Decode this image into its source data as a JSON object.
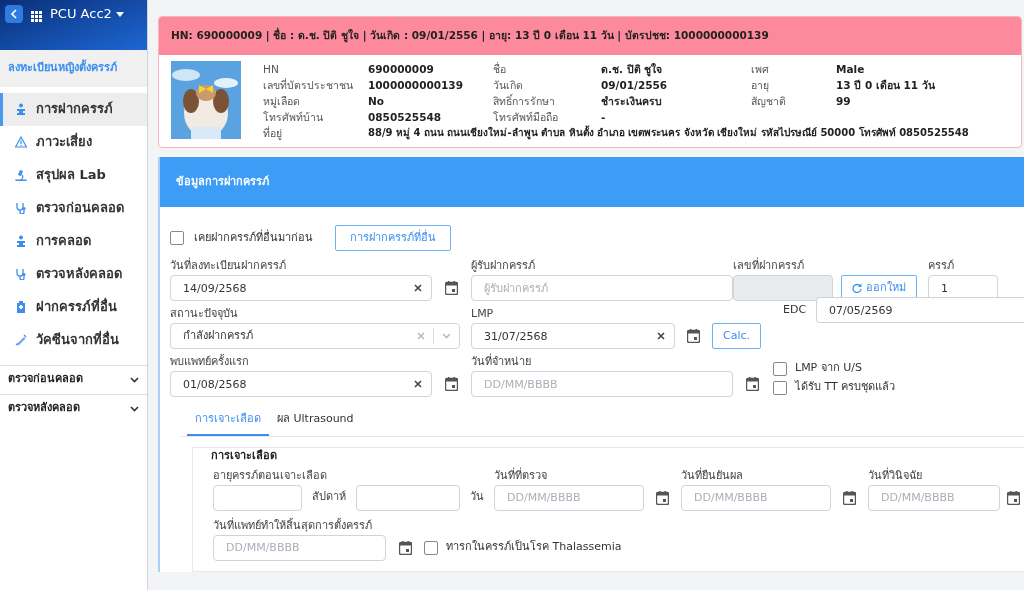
{
  "app": {
    "title": "PCU Acc2"
  },
  "sidebar": {
    "section_title": "ลงทะเบียนหญิงตั้งครรภ์",
    "items": [
      {
        "label": "การฝากครรภ์",
        "selected": true
      },
      {
        "label": "ภาวะเสี่ยง",
        "selected": false
      },
      {
        "label": "สรุปผล Lab",
        "selected": false
      },
      {
        "label": "ตรวจก่อนคลอด",
        "selected": false
      },
      {
        "label": "การคลอด",
        "selected": false
      },
      {
        "label": "ตรวจหลังคลอด",
        "selected": false
      },
      {
        "label": "ฝากครรภ์ที่อื่น",
        "selected": false
      },
      {
        "label": "วัคซีนจากที่อื่น",
        "selected": false
      }
    ],
    "groups": [
      {
        "label": "ตรวจก่อนคลอด",
        "expanded": false
      },
      {
        "label": "ตรวจหลังคลอด",
        "expanded": false
      }
    ]
  },
  "patient": {
    "banner": "HN: 690000009 | ชื่อ : ด.ช. ปิติ ชูใจ | วันเกิด : 09/01/2556 | อายุ: 13 ปี 0 เดือน 11 วัน | บัตรปชช: 1000000000139",
    "info": [
      {
        "label": "HN",
        "value": "690000009"
      },
      {
        "label": "ชื่อ",
        "value": "ด.ช. ปิติ ชูใจ"
      },
      {
        "label": "เพศ",
        "value": "Male"
      },
      {
        "label": "เลขที่บัตรประชาชน",
        "value": "1000000000139"
      },
      {
        "label": "วันเกิด",
        "value": "09/01/2556"
      },
      {
        "label": "อายุ",
        "value": "13 ปี 0 เดือน 11 วัน"
      },
      {
        "label": "หมู่เลือด",
        "value": "No"
      },
      {
        "label": "สิทธิ์การรักษา",
        "value": "ชำระเงินครบ"
      },
      {
        "label": "สัญชาติ",
        "value": "99"
      },
      {
        "label": "โทรศัพท์บ้าน",
        "value": "0850525548"
      },
      {
        "label": "โทรศัพท์มือถือ",
        "value": "-"
      }
    ],
    "address": {
      "label": "ที่อยู่",
      "value": "88/9 หมู่ 4 ถนน ถนนเชียงใหม่-ลำพูน ตำบล หินตั้ง อำเภอ เขตพระนคร จังหวัด เชียงใหม่ รหัสไปรษณีย์ 50000 โทรศัพท์ 0850525548"
    }
  },
  "form": {
    "title": "ข้อมูลการฝากครรภ์",
    "prior": {
      "label": "เคยฝากครรภ์ที่อื่นมาก่อน",
      "checked": false
    },
    "other_button": "การฝากครรภ์ที่อื่น",
    "rows": [
      [
        {
          "kind": "date",
          "label": "วันที่ลงทะเบียนฝากครรภ์",
          "value": "14/09/2568"
        },
        {
          "kind": "text",
          "label": "ผู้รับฝากครรภ์",
          "placeholder": "ผู้รับฝากครรภ์"
        },
        {
          "kind": "readonly",
          "label": "เลขที่ฝากครรภ์",
          "button": "ออกใหม่"
        },
        {
          "kind": "number",
          "label": "ครรภ์",
          "value": "1"
        }
      ],
      [
        {
          "kind": "select",
          "label": "สถานะปัจจุบัน",
          "value": "กำลังฝากครรภ์"
        },
        {
          "kind": "lmp",
          "label": "LMP",
          "value": "31/07/2568",
          "button": "Calc."
        },
        {
          "kind": "edc",
          "label": "EDC",
          "value": "07/05/2569"
        }
      ],
      [
        {
          "kind": "date",
          "label": "พบแพทย์ครั้งแรก",
          "value": "01/08/2568"
        },
        {
          "kind": "date",
          "label": "วันที่จำหน่าย",
          "placeholder": "DD/MM/BBBB"
        },
        {
          "kind": "checks",
          "items": [
            {
              "label": "LMP จาก U/S",
              "checked": false
            },
            {
              "label": "ได้รับ TT ครบชุดแล้ว",
              "checked": false
            }
          ]
        }
      ]
    ]
  },
  "tabs": [
    {
      "label": "การเจาะเลือด",
      "selected": true
    },
    {
      "label": "ผล Ultrasound",
      "selected": false
    }
  ],
  "blood_test": {
    "legend": "การเจาะเลือด",
    "gestational_age": {
      "label": "อายุครรภ์ตอนเจาะเลือด",
      "weeks_unit": "สัปดาห์",
      "days_unit": "วัน"
    },
    "dates": [
      {
        "label": "วันที่ที่ตรวจ",
        "placeholder": "DD/MM/BBBB"
      },
      {
        "label": "วันที่ยืนยันผล",
        "placeholder": "DD/MM/BBBB"
      },
      {
        "label": "วันที่วินิจฉัย",
        "placeholder": "DD/MM/BBBB"
      }
    ],
    "termination": {
      "label": "วันที่แพทย์ทำให้สิ้นสุดการตั้งครรภ์",
      "placeholder": "DD/MM/BBBB"
    },
    "thalassemia": {
      "label": "ทารกในครรภ์เป็นโรค Thalassemia",
      "checked": false
    }
  }
}
